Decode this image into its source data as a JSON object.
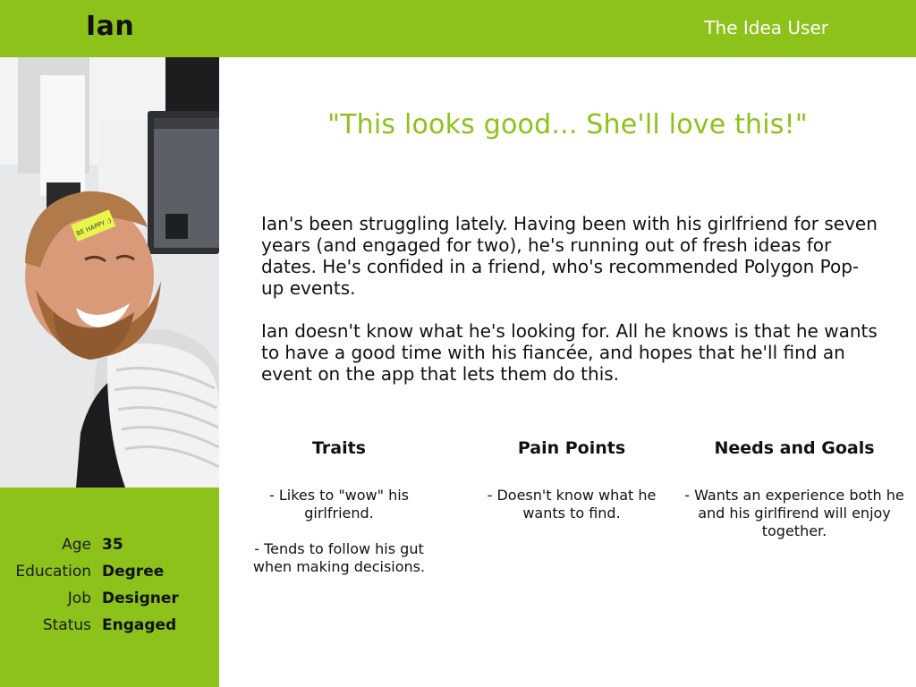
{
  "header": {
    "name": "Ian",
    "persona_type": "The Idea User",
    "accent_color": "#8dc21a"
  },
  "photo": {
    "subject": "bearded man smiling at office desk",
    "sticky_note": "BE HAPPY :)"
  },
  "stats": [
    {
      "label": "Age",
      "value": "35"
    },
    {
      "label": "Education",
      "value": "Degree"
    },
    {
      "label": "Job",
      "value": "Designer"
    },
    {
      "label": "Status",
      "value": "Engaged"
    }
  ],
  "quote": "\"This looks good... She'll love this!\"",
  "bio": {
    "paragraph_1": "Ian's been struggling lately. Having been with his girlfriend for seven years (and engaged for two), he's running out of fresh ideas for dates. He's confided in a friend, who's recommended Polygon Pop-up events.",
    "paragraph_2": "Ian doesn't know what he's looking for. All he knows is that he wants to have a good time with his fiancée, and hopes that he'll find an event on the app that lets them do this."
  },
  "traits": {
    "title": "Traits",
    "items": [
      "- Likes to \"wow\" his girlfriend.",
      "- Tends to follow his gut when making decisions."
    ]
  },
  "pain_points": {
    "title": "Pain Points",
    "items": [
      "- Doesn't know what he wants to find."
    ]
  },
  "needs_goals": {
    "title": "Needs and Goals",
    "items": [
      "- Wants an experience both he and his girlfirend will enjoy together."
    ]
  }
}
